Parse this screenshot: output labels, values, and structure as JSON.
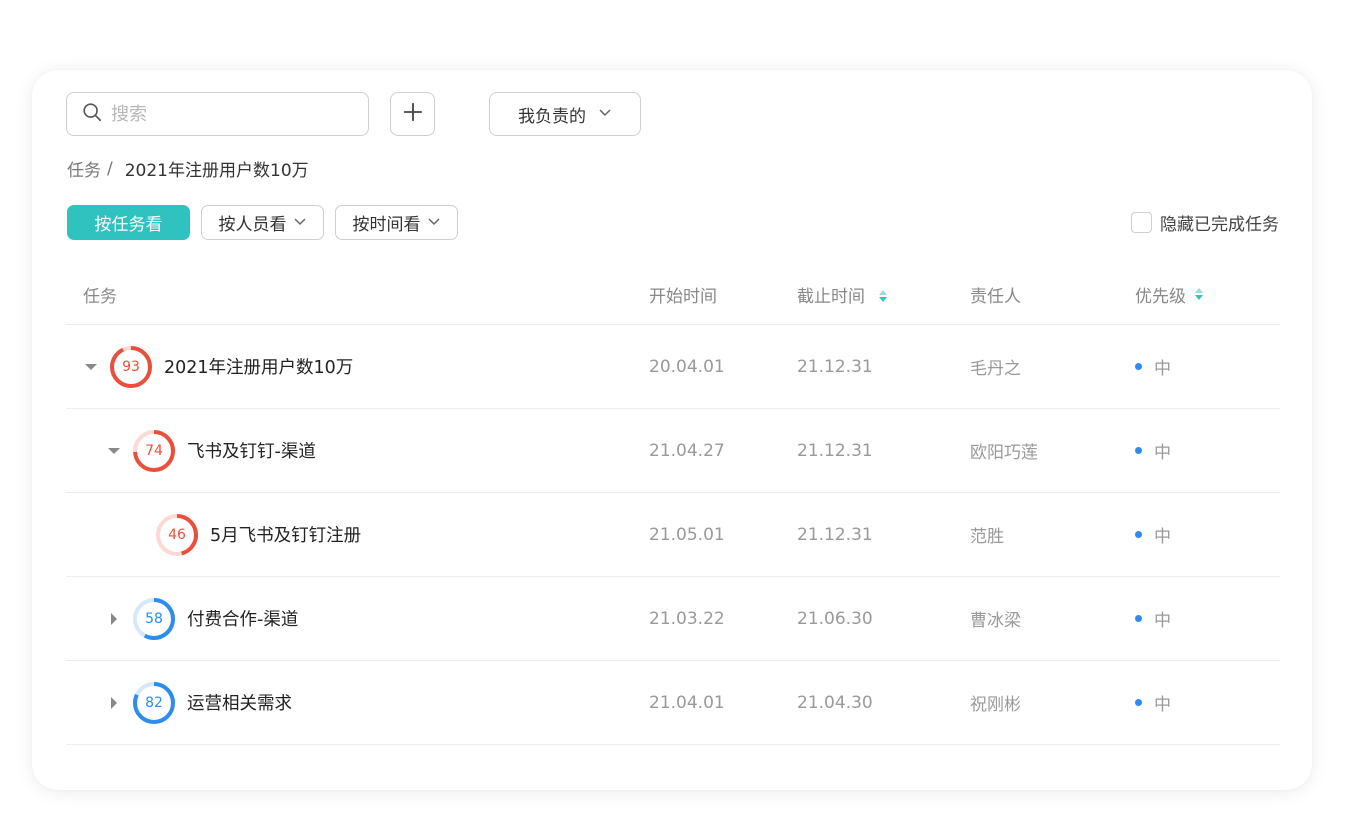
{
  "search": {
    "placeholder": "搜索",
    "value": ""
  },
  "owner_filter": {
    "label": "我负责的"
  },
  "breadcrumb": {
    "root": "任务",
    "separator": "/",
    "current": "2021年注册用户数10万"
  },
  "views": {
    "by_task": "按任务看",
    "by_person": "按人员看",
    "by_time": "按时间看"
  },
  "hide_completed": {
    "label": "隐藏已完成任务",
    "checked": false
  },
  "columns": {
    "task": "任务",
    "start": "开始时间",
    "end": "截止时间",
    "owner": "责任人",
    "priority": "优先级"
  },
  "colors": {
    "accent": "#2fc2bf",
    "progress_red": "#ea4f3c",
    "progress_red_light": "#fbd9d4",
    "progress_blue": "#2d8cf0",
    "progress_blue_light": "#d6e8fc",
    "priority_dot": "#2d8cf0"
  },
  "rows": [
    {
      "name": "2021年注册用户数10万",
      "progress": "93",
      "start": "20.04.01",
      "end": "21.12.31",
      "owner": "毛丹之",
      "priority": "中",
      "toggle": "expanded"
    },
    {
      "name": "飞书及钉钉-渠道",
      "progress": "74",
      "start": "21.04.27",
      "end": "21.12.31",
      "owner": "欧阳巧莲",
      "priority": "中",
      "toggle": "expanded"
    },
    {
      "name": "5月飞书及钉钉注册",
      "progress": "46",
      "start": "21.05.01",
      "end": "21.12.31",
      "owner": "范胜",
      "priority": "中",
      "toggle": "none"
    },
    {
      "name": "付费合作-渠道",
      "progress": "58",
      "start": "21.03.22",
      "end": "21.06.30",
      "owner": "曹冰梁",
      "priority": "中",
      "toggle": "collapsed"
    },
    {
      "name": "运营相关需求",
      "progress": "82",
      "start": "21.04.01",
      "end": "21.04.30",
      "owner": "祝刚彬",
      "priority": "中",
      "toggle": "collapsed"
    }
  ]
}
